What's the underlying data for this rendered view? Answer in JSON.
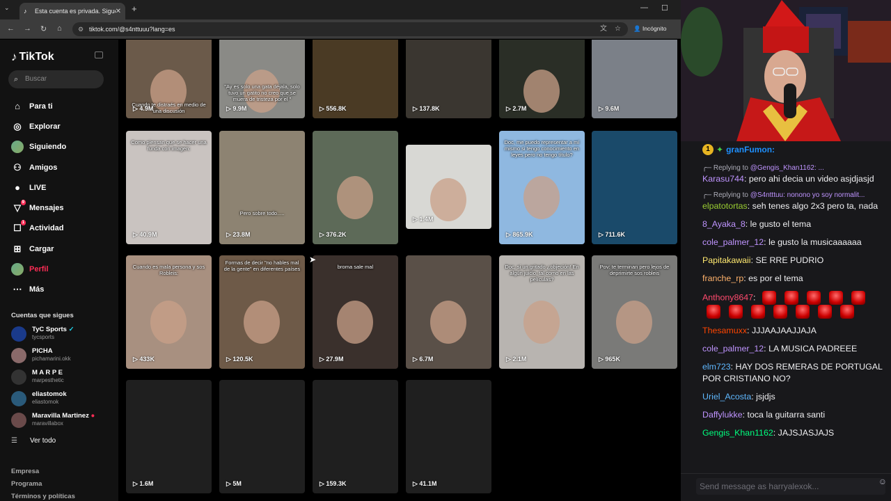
{
  "browser": {
    "tab_title": "Esta cuenta es privada. Sigue a",
    "url": "tiktok.com/@s4nttuuu?lang=es",
    "incognito_label": "Incógnito"
  },
  "tiktok": {
    "logo": "TikTok",
    "search_placeholder": "Buscar",
    "menu": [
      {
        "label": "Para ti",
        "icon": "home-icon"
      },
      {
        "label": "Explorar",
        "icon": "compass-icon"
      },
      {
        "label": "Siguiendo",
        "icon": "following-avatar-icon"
      },
      {
        "label": "Amigos",
        "icon": "friends-icon"
      },
      {
        "label": "LIVE",
        "icon": "live-icon"
      },
      {
        "label": "Mensajes",
        "icon": "messages-icon",
        "badge": "9"
      },
      {
        "label": "Actividad",
        "icon": "activity-icon",
        "badge": "1"
      },
      {
        "label": "Cargar",
        "icon": "upload-icon"
      },
      {
        "label": "Perfil",
        "icon": "profile-avatar-icon",
        "active": true
      },
      {
        "label": "Más",
        "icon": "more-icon"
      }
    ],
    "follows_title": "Cuentas que sigues",
    "follows": [
      {
        "name": "TyC Sports",
        "handle": "tycsports",
        "verified": true
      },
      {
        "name": "PICHA",
        "handle": "pichamarini.okk"
      },
      {
        "name": "M A R P E",
        "handle": "marpesthetic"
      },
      {
        "name": "eliastomok",
        "handle": "eliastomok"
      },
      {
        "name": "Maravilla Martinez",
        "handle": "maravillabox",
        "flag": true
      }
    ],
    "ver_todo": "Ver todo",
    "footer_links": [
      "Empresa",
      "Programa",
      "Términos y políticas"
    ]
  },
  "videos": [
    {
      "views": "4.9M",
      "caption": "Cuando te distraés en medio de una discusión",
      "bg": "#6b5a4a"
    },
    {
      "views": "9.9M",
      "caption": "\"Ay es solo una gata déjala, solo tuvo un gatito no creo que se muera de tristeza por el \"",
      "bg": "#8a8a86"
    },
    {
      "views": "556.8K",
      "caption": "",
      "bg": "#4a3a24"
    },
    {
      "views": "137.8K",
      "caption": "",
      "bg": "#3a3630"
    },
    {
      "views": "2.7M",
      "caption": "",
      "bg": "#2a2e26"
    },
    {
      "views": "9.6M",
      "caption": "",
      "bg": "#7b8088"
    },
    {
      "views": "40.9M",
      "caption": "Como piensan que se hacer una funda con imagen:",
      "bg": "#c9c3c0"
    },
    {
      "views": "23.8M",
      "caption": "Pero sobre todo.....",
      "bg": "#8d8372"
    },
    {
      "views": "376.2K",
      "caption": "",
      "bg": "#5d6a58"
    },
    {
      "views": "1.4M",
      "caption": "",
      "bg": "#d8d8d4"
    },
    {
      "views": "865.9K",
      "caption": "Doc, me puedo representar a mí mismo si tengo conocimiento en leyes pero no tengo título?",
      "bg": "#8fb8e0"
    },
    {
      "views": "711.6K",
      "caption": "",
      "bg": "#1a4a6a"
    },
    {
      "views": "433K",
      "caption": "Cuando es mala persona y sos Robleis:",
      "bg": "#a89080"
    },
    {
      "views": "120.5K",
      "caption": "Formas de decir \"no hables mal de la gente\" en diferentes países",
      "bg": "#6e5a48"
    },
    {
      "views": "27.9M",
      "caption": "broma sale mal",
      "bg": "#3a302c"
    },
    {
      "views": "6.7M",
      "caption": "",
      "bg": "#5a5048"
    },
    {
      "views": "2.1M",
      "caption": "Doc, si un gritado ¿objeción! En algún juicio, tal como en las películas?",
      "bg": "#b8b4b0"
    },
    {
      "views": "965K",
      "caption": "Pov: te terminan pero lejos de deprimirte sos robleis",
      "bg": "#7a7a78"
    },
    {
      "views": "1.6M",
      "caption": "",
      "bg": "#1f1f1f"
    },
    {
      "views": "5M",
      "caption": "",
      "bg": "#1f1f1f"
    },
    {
      "views": "159.3K",
      "caption": "",
      "bg": "#1f1f1f"
    },
    {
      "views": "41.1M",
      "caption": "",
      "bg": "#1f1f1f"
    }
  ],
  "chat": {
    "top_chatter": {
      "rank": "1",
      "name": "granFumon:"
    },
    "messages": [
      {
        "reply_to": "@Gengis_Khan1162: ...",
        "user": "Karasu744",
        "color": "#bf94ff",
        "text": "pero ahi decia un video asjdjasjd"
      },
      {
        "reply_to": "@S4ntttuu: nonono yo soy normalit...",
        "user": "elpatotortas",
        "color": "#9acd32",
        "text": "seh tenes algo 2x3 pero ta, nada"
      },
      {
        "user": "8_Ayaka_8",
        "color": "#bf94ff",
        "text": "le gusto el tema"
      },
      {
        "user": "cole_palmer_12",
        "color": "#bf94ff",
        "text": "le gusto la musicaaaaaa"
      },
      {
        "user": "Papitakawaii",
        "color": "#ffe970",
        "text": "SE RRE PUDRIO"
      },
      {
        "user": "franche_rp",
        "color": "#ffb26b",
        "text": "es por el tema"
      },
      {
        "user": "Anthony8647",
        "color": "#ff4a6e",
        "text": "",
        "emotes": 12
      },
      {
        "user": "Thesamuxx",
        "color": "#ff4500",
        "text": "JJJAAJAAJJAJA"
      },
      {
        "user": "cole_palmer_12",
        "color": "#bf94ff",
        "text": "LA MUSICA PADREEE"
      },
      {
        "user": "elm723",
        "color": "#5fb8ff",
        "text": "HAY DOS REMERAS DE PORTUGAL POR CRISTIANO NO?"
      },
      {
        "user": "Uriel_Acosta",
        "color": "#5fb8ff",
        "text": "jsjdjs"
      },
      {
        "user": "Daffylukke",
        "color": "#bf94ff",
        "text": "toca la guitarra santi"
      },
      {
        "user": "Gengis_Khan1162",
        "color": "#00ff7f",
        "text": "JAJSJASJAJS"
      }
    ],
    "input_placeholder": "Send message as harryalexok..."
  }
}
